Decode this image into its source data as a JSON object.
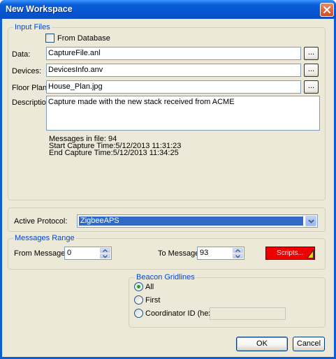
{
  "window": {
    "title": "New Workspace"
  },
  "input_files": {
    "legend": "Input Files",
    "from_database_label": "From Database",
    "from_database_checked": false,
    "data_label": "Data:",
    "data_value": "CaptureFile.anl",
    "devices_label": "Devices:",
    "devices_value": "DevicesInfo.anv",
    "floor_plan_label": "Floor Plan:",
    "floor_plan_value": "House_Plan.jpg",
    "description_label": "Description:",
    "description_value": "Capture made with the new stack received from ACME",
    "browse_label": "...",
    "info_messages": "Messages in file: 94",
    "info_start": "Start Capture Time:5/12/2013 11:31:23",
    "info_end": "End Capture Time:5/12/2013 11:34:25"
  },
  "protocol": {
    "label": "Active Protocol:",
    "value": "ZigbeeAPS"
  },
  "messages_range": {
    "legend": "Messages Range",
    "from_label": "From Message:",
    "from_value": "0",
    "to_label": "To Message:",
    "to_value": "93",
    "scripts_label": "Scripts..."
  },
  "beacon": {
    "legend": "Beacon Gridlines",
    "options": [
      {
        "label": "All",
        "selected": true
      },
      {
        "label": "First",
        "selected": false
      },
      {
        "label": "Coordinator ID (hex)",
        "selected": false
      }
    ],
    "coordinator_value": ""
  },
  "buttons": {
    "ok": "OK",
    "cancel": "Cancel"
  },
  "colors": {
    "titlebar": "#0a5ed6",
    "face": "#ece9d8",
    "legend_text": "#0046d5",
    "scripts_button": "#ee0000",
    "selection": "#316ac5"
  }
}
